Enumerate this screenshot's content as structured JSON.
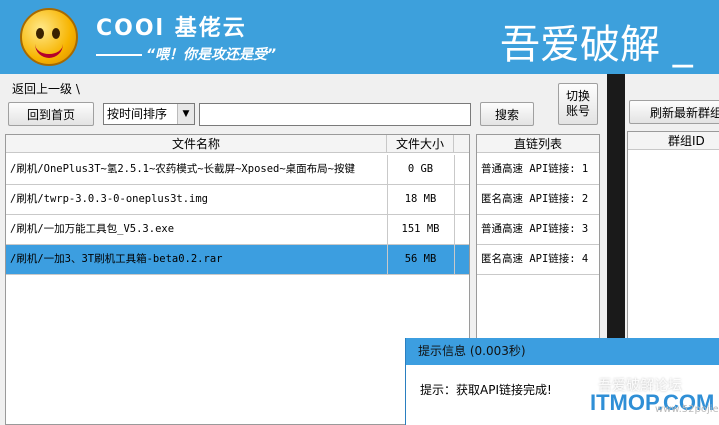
{
  "banner": {
    "brand": "COOl 基佬云",
    "slogan": "“喂！你是攻还是受”",
    "title": "吾爱破解 _"
  },
  "toolbar": {
    "back_label": "返回上一级 \\",
    "home_label": "回到首页",
    "sort_selected": "按时间排序",
    "search_value": "",
    "search_label": "搜索",
    "switch_label": "切换账号"
  },
  "files": {
    "columns": [
      "文件名称",
      "文件大小"
    ],
    "rows": [
      {
        "name": "/刷机/OnePlus3T~氢2.5.1~农药模式~长截屏~Xposed~桌面布局~按键",
        "size": "0 GB"
      },
      {
        "name": "/刷机/twrp-3.0.3-0-oneplus3t.img",
        "size": "18 MB"
      },
      {
        "name": "/刷机/一加万能工具包_V5.3.exe",
        "size": "151 MB"
      },
      {
        "name": "/刷机/一加3、3T刷机工具箱-beta0.2.rar",
        "size": "56 MB"
      }
    ]
  },
  "links": {
    "header": "直链列表",
    "rows": [
      "普通高速 API链接: 1",
      "匿名高速 API链接: 2",
      "普通高速 API链接: 3",
      "匿名高速 API链接: 4"
    ]
  },
  "right": {
    "refresh_label": "刷新最新群组",
    "column": "群组ID"
  },
  "popup": {
    "title": "提示信息  (0.003秒)",
    "message": "提示：获取API链接完成!"
  },
  "watermark": {
    "line1": "吾爱破解论坛",
    "line2": "ITMOP.COM",
    "line3": "www.52pojie.cn"
  },
  "colors": {
    "banner": "#3da0dc",
    "selection": "#3c9ee0"
  }
}
